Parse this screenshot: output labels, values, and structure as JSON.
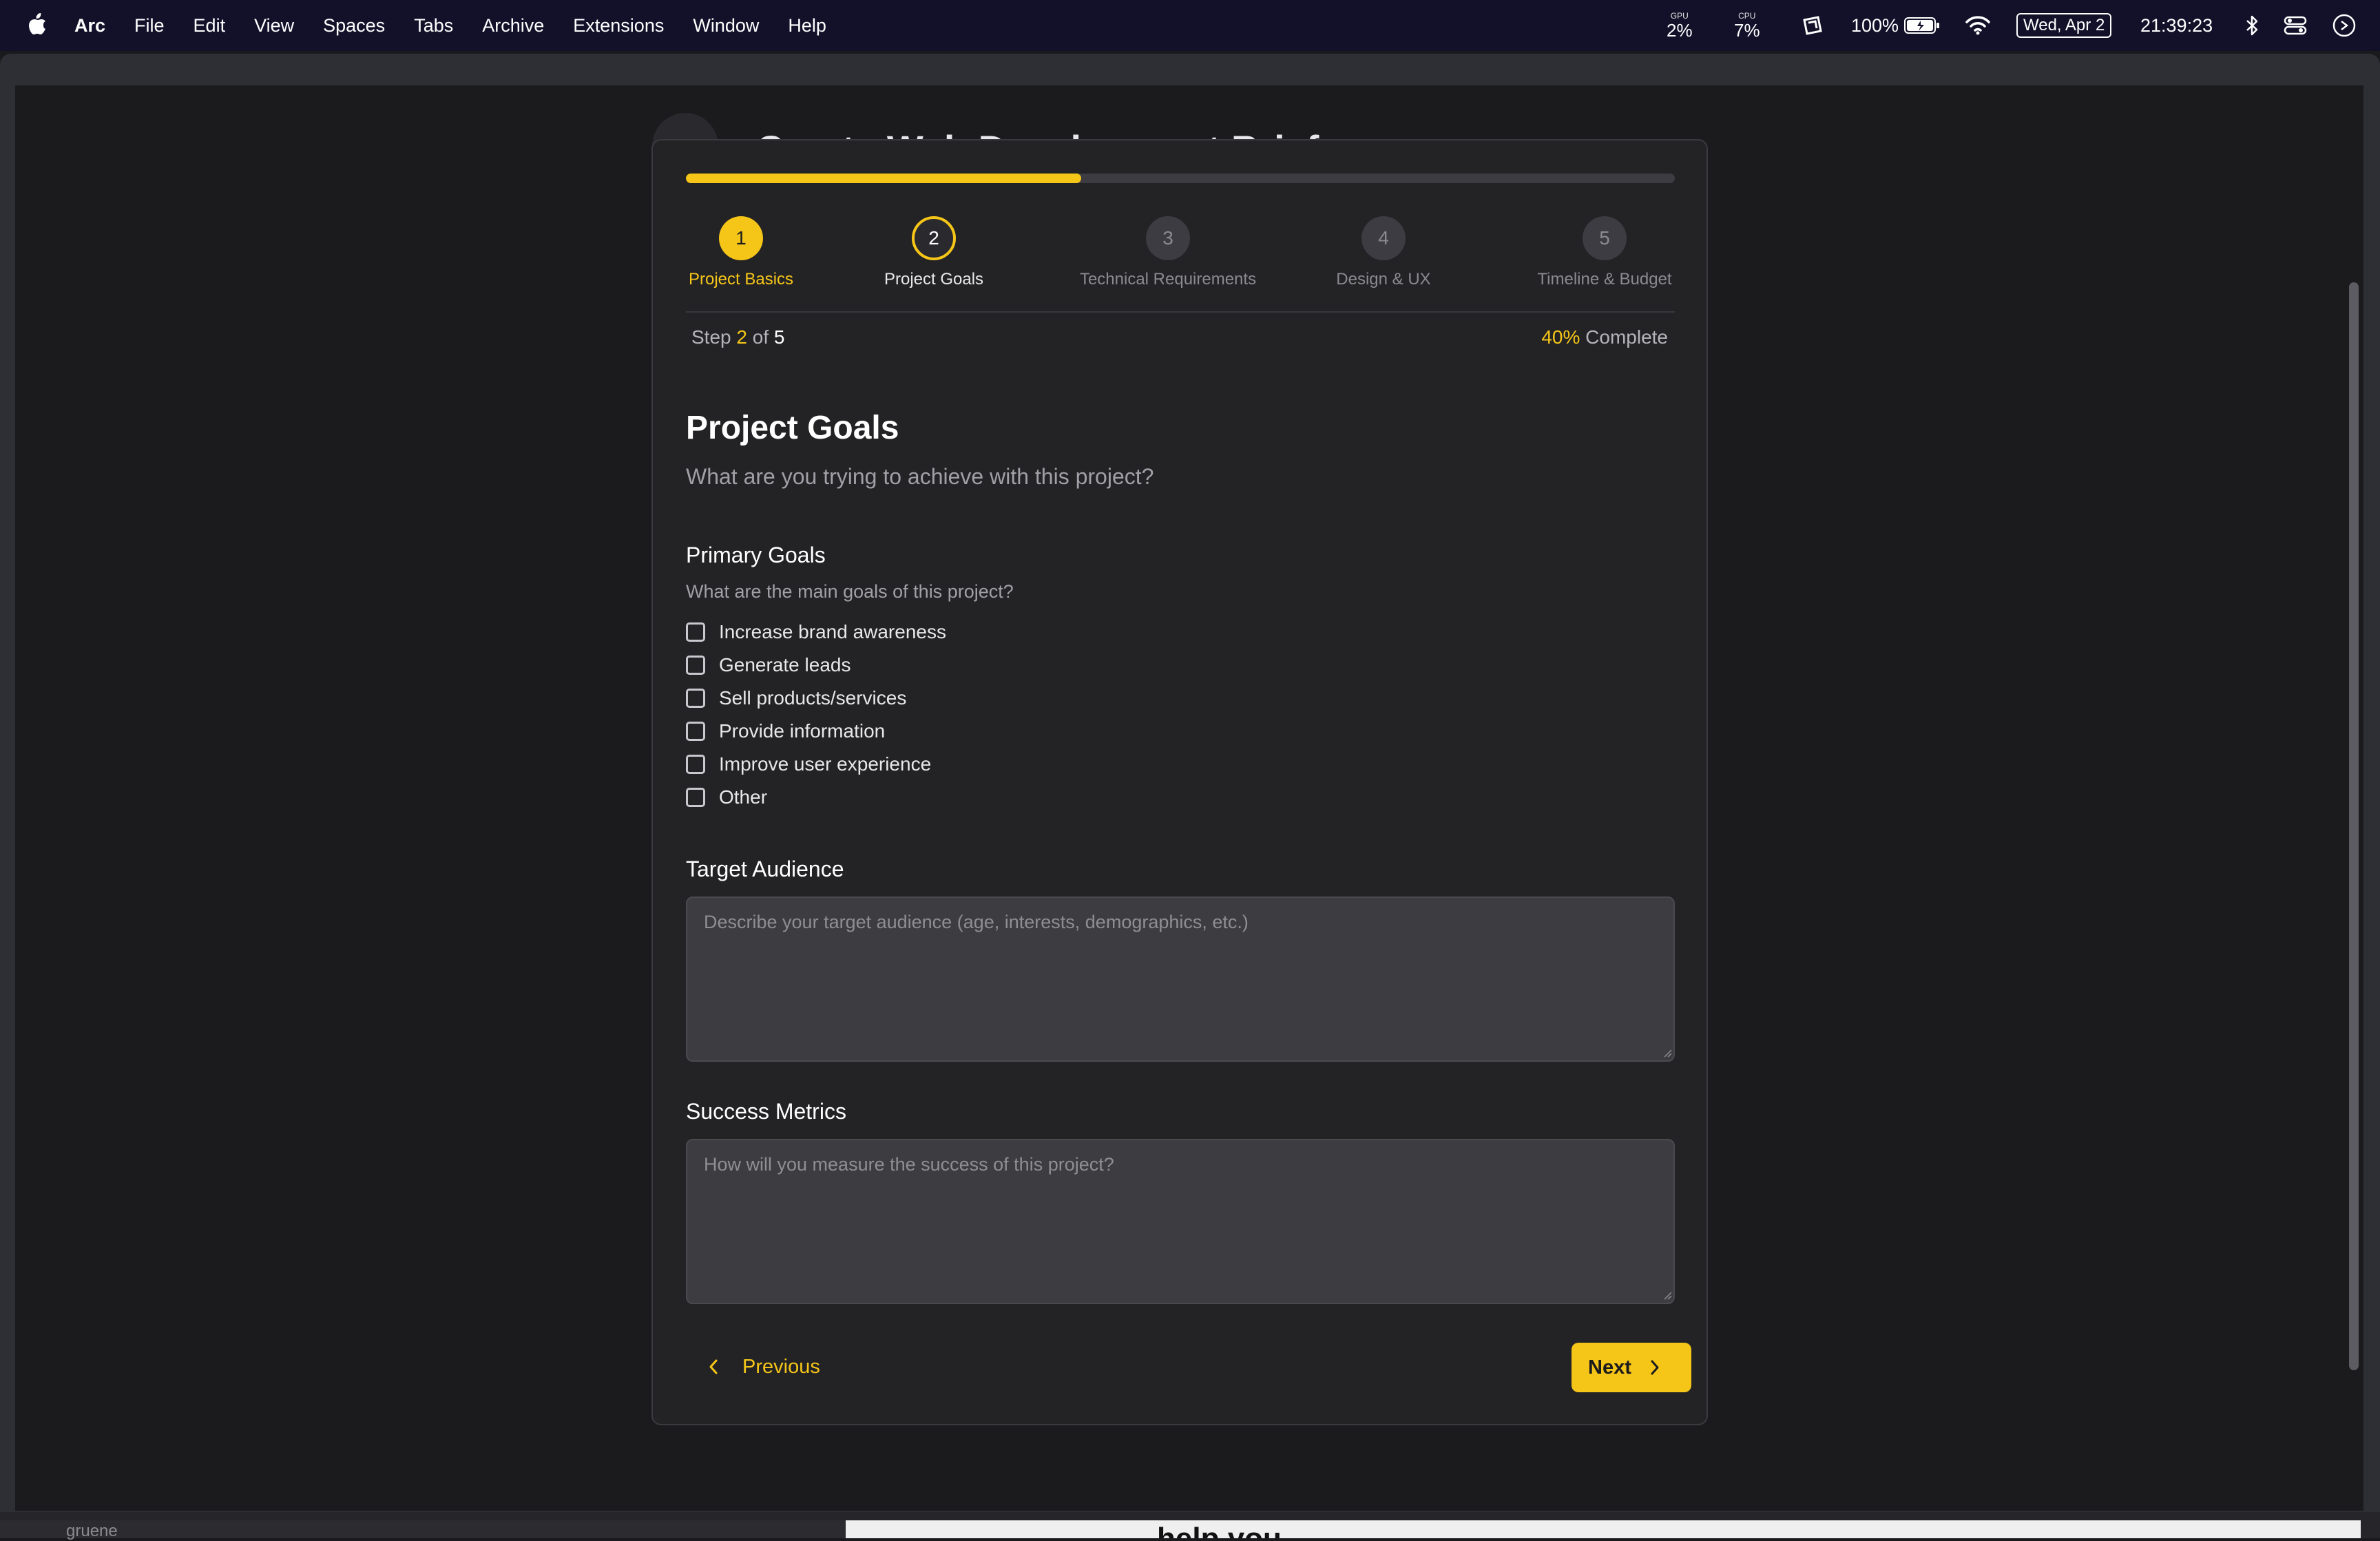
{
  "menubar": {
    "app_name": "Arc",
    "menus": [
      "File",
      "Edit",
      "View",
      "Spaces",
      "Tabs",
      "Archive",
      "Extensions",
      "Window",
      "Help"
    ],
    "gpu_label": "GPU",
    "gpu_value": "2%",
    "cpu_label": "CPU",
    "cpu_value": "7%",
    "battery": "100%",
    "date": "Wed, Apr 2",
    "time": "21:39:23"
  },
  "page": {
    "title_partial": "Create Web Development Brief"
  },
  "wizard": {
    "progress_percent": 40,
    "steps": [
      {
        "number": "1",
        "label": "Project Basics",
        "state": "done"
      },
      {
        "number": "2",
        "label": "Project Goals",
        "state": "active"
      },
      {
        "number": "3",
        "label": "Technical Requirements",
        "state": "pending"
      },
      {
        "number": "4",
        "label": "Design & UX",
        "state": "pending"
      },
      {
        "number": "5",
        "label": "Timeline & Budget",
        "state": "pending"
      }
    ],
    "step_prefix": "Step",
    "step_current": "2",
    "step_of": "of",
    "step_total": "5",
    "percent_value": "40%",
    "percent_suffix": "Complete"
  },
  "section": {
    "title": "Project Goals",
    "subtitle": "What are you trying to achieve with this project?"
  },
  "primary_goals": {
    "label": "Primary Goals",
    "help": "What are the main goals of this project?",
    "options": [
      {
        "label": "Increase brand awareness",
        "checked": false
      },
      {
        "label": "Generate leads",
        "checked": false
      },
      {
        "label": "Sell products/services",
        "checked": false
      },
      {
        "label": "Provide information",
        "checked": false
      },
      {
        "label": "Improve user experience",
        "checked": false
      },
      {
        "label": "Other",
        "checked": false
      }
    ]
  },
  "target_audience": {
    "label": "Target Audience",
    "value": "",
    "placeholder": "Describe your target audience (age, interests, demographics, etc.)"
  },
  "success_metrics": {
    "label": "Success Metrics",
    "value": "",
    "placeholder": "How will you measure the success of this project?"
  },
  "nav": {
    "previous_label": "Previous",
    "next_label": "Next"
  },
  "background": {
    "left_text": "gruene",
    "right_text": "help you."
  },
  "colors": {
    "accent": "#f5c518",
    "card_bg": "#232325",
    "page_bg": "#1b1b1d",
    "input_bg": "#3c3c41"
  }
}
